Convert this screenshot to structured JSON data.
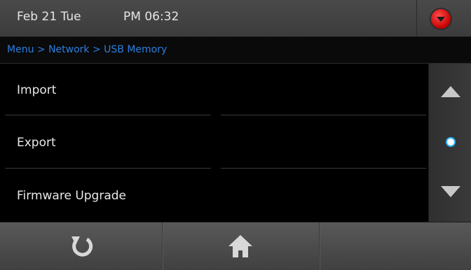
{
  "status": {
    "date": "Feb 21 Tue",
    "time": "PM 06:32"
  },
  "breadcrumb": "Menu > Network > USB Memory",
  "menu": {
    "items": [
      {
        "label": "Import"
      },
      {
        "label": "Export"
      },
      {
        "label": "Firmware Upgrade"
      }
    ]
  },
  "colors": {
    "breadcrumb": "#2b7fe0",
    "alert": "#d40000",
    "scroll_indicator": "#2bb3ff"
  },
  "icons": {
    "alert": "red-down-arrow-icon",
    "scroll_up": "scroll-up-icon",
    "scroll_indicator": "scroll-position-dot",
    "scroll_down": "scroll-down-icon",
    "refresh": "refresh-icon",
    "home": "home-icon"
  }
}
